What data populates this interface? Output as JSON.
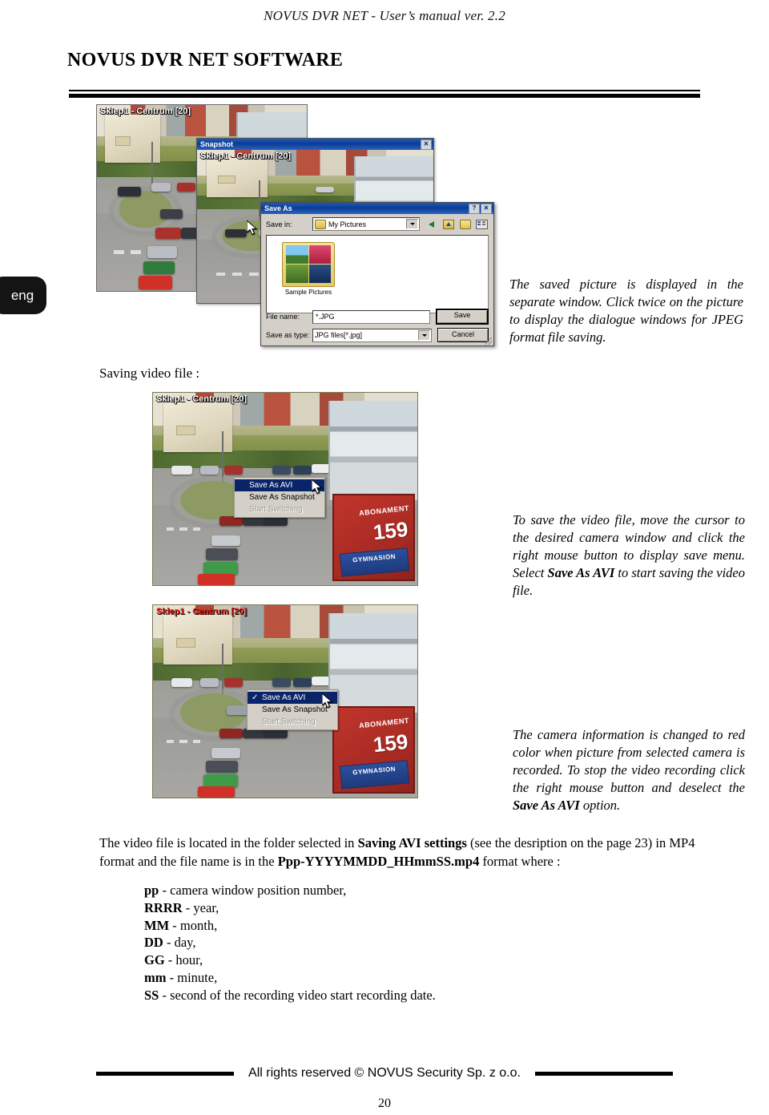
{
  "header": {
    "running_title": "NOVUS DVR NET  - User’s manual ver. 2.2"
  },
  "title": "NOVUS DVR NET SOFTWARE",
  "side_tab": {
    "label": "eng"
  },
  "figure_snapshot": {
    "back_window": {
      "camera_label": "Sklep1 - Centrum [20]"
    },
    "snapshot_window": {
      "title": "Snapshot",
      "close_label": "✕",
      "camera_label": "Sklep1 - Centrum [20]"
    },
    "save_as_dialog": {
      "title": "Save As",
      "help_label": "?",
      "close_label": "✕",
      "save_in_label": "Save in:",
      "save_in_value": "My Pictures",
      "folder_item": "Sample Pictures",
      "file_name_label": "File name:",
      "file_name_value": "*.JPG",
      "save_as_type_label": "Save as type:",
      "save_as_type_value": "JPG files[*.jpg]",
      "save_button": "Save",
      "cancel_button": "Cancel"
    }
  },
  "note_snapshot": "The saved picture is displayed in the separate window. Click twice on the picture to display the dialogue windows for JPEG  format file saving.",
  "section_saving_video": "Saving video file :",
  "figure_menu_1": {
    "camera_label": "Sklep1 - Centrum [20]",
    "label_color": "#ffffff",
    "billboard_text": "ABONAMENT",
    "billboard_number": "159",
    "billboard_brand": "GYMNASION",
    "menu": [
      {
        "label": "Save As AVI",
        "selected": true,
        "checked": false,
        "disabled": false
      },
      {
        "label": "Save As Snapshot",
        "selected": false,
        "checked": false,
        "disabled": false
      },
      {
        "label": "Start Switching",
        "selected": false,
        "checked": false,
        "disabled": true
      }
    ]
  },
  "figure_menu_2": {
    "camera_label": "Sklep1 - Centrum [20]",
    "label_color": "#e8201a",
    "billboard_text": "ABONAMENT",
    "billboard_number": "159",
    "billboard_brand": "GYMNASION",
    "menu": [
      {
        "label": "Save As AVI",
        "selected": true,
        "checked": true,
        "disabled": false
      },
      {
        "label": "Save As Snapshot",
        "selected": false,
        "checked": false,
        "disabled": false
      },
      {
        "label": "Start Switching",
        "selected": false,
        "checked": false,
        "disabled": true
      }
    ]
  },
  "note_save_avi": {
    "part1": "To save the video file, move the cursor to the desired camera window and click the right mouse button to display save menu. Select ",
    "bold": "Save As AVI",
    "part2": " to start saving the video file."
  },
  "note_recording": {
    "part1": "The camera information is changed to red color when picture from selected camera is recorded. To stop the video recording click the right mouse button and deselect the ",
    "bold": "Save As AVI",
    "part2": " option."
  },
  "body_paragraph": {
    "part1": "The video file is located in the folder selected in ",
    "bold1": "Saving AVI settings",
    "part2": " (see the desription on the page 23) in MP4 format and the file name is in the ",
    "bold2": "Ppp-YYYYMMDD_HHmmSS.mp4",
    "part3": " format where :"
  },
  "definitions": [
    {
      "term": "pp",
      "desc": " - camera window position number,"
    },
    {
      "term": "RRRR",
      "desc": " - year,"
    },
    {
      "term": "MM",
      "desc": " - month,"
    },
    {
      "term": "DD",
      "desc": " - day,"
    },
    {
      "term": "GG",
      "desc": " - hour,"
    },
    {
      "term": "mm",
      "desc": " - minute,"
    },
    {
      "term": "SS",
      "desc": " - second of the recording video start recording date."
    }
  ],
  "footer": {
    "text": "All rights reserved © NOVUS Security Sp. z o.o.",
    "page_number": "20"
  }
}
